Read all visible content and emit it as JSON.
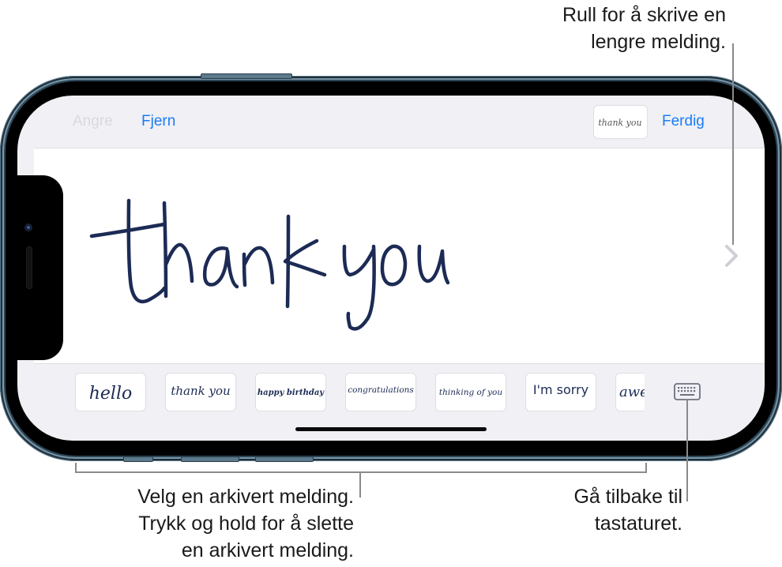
{
  "callouts": {
    "scroll": {
      "line1": "Rull for å skrive en",
      "line2": "lengre melding."
    },
    "saved": {
      "line1": "Velg en arkivert melding.",
      "line2": "Trykk og hold for å slette",
      "line3": "en arkivert melding."
    },
    "keyboard": {
      "line1": "Gå tilbake til",
      "line2": "tastaturet."
    }
  },
  "toolbar": {
    "undo_label": "Angre",
    "remove_label": "Fjern",
    "done_label": "Ferdig",
    "preview_text": "thank you"
  },
  "canvas": {
    "handwriting_text": "thank you",
    "ink_color": "#1c2b55",
    "next_icon": "chevron-right-icon"
  },
  "saved_messages": [
    {
      "text": "hello"
    },
    {
      "text": "thank you"
    },
    {
      "text": "happy birthday"
    },
    {
      "text": "congratulations"
    },
    {
      "text": "thinking of you"
    },
    {
      "text": "I'm sorry"
    },
    {
      "text": "awe"
    }
  ],
  "keyboard_button": {
    "icon": "keyboard-icon"
  },
  "colors": {
    "accent": "#1a7cf5",
    "disabled": "#d9d9de",
    "screen_bg": "#f0f0f5",
    "frame": "#2c4656"
  }
}
